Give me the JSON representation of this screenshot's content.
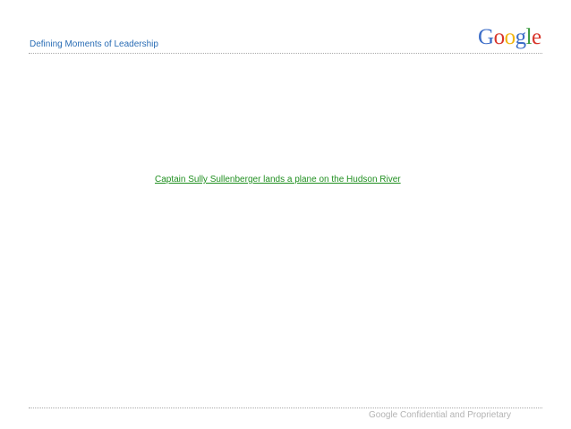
{
  "header": {
    "title": "Defining Moments of Leadership"
  },
  "logo": {
    "letters": [
      "G",
      "o",
      "o",
      "g",
      "l",
      "e"
    ],
    "colors": [
      "#3d6ec8",
      "#d8352b",
      "#f2b50f",
      "#3d6ec8",
      "#3a9a3f",
      "#d8352b"
    ]
  },
  "main": {
    "link_text": "Captain Sully Sullenberger lands a plane on the Hudson River",
    "link_color": "#1f8f1f"
  },
  "footer": {
    "text": "Google Confidential and Proprietary"
  }
}
